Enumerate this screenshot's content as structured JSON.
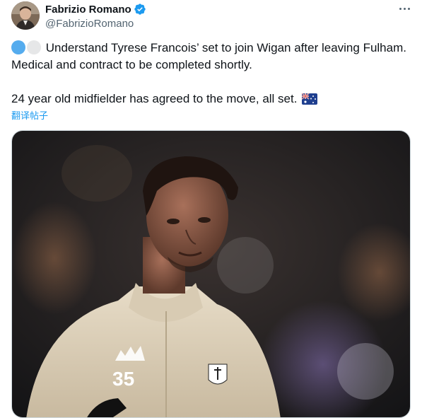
{
  "tweet": {
    "author": {
      "display_name": "Fabrizio Romano",
      "handle": "@FabrizioRomano",
      "verified": true,
      "avatar_icon": "profile-photo"
    },
    "more_icon": "ellipsis-icon",
    "text_line1": "Understand Tyrese Francois’ set to join Wigan after leaving Fulham. Medical and contract to be completed shortly.",
    "text_line2": "24 year old midfielder has agreed to the move, all set.",
    "emoji_prefix": [
      "blue-circle",
      "white-circle"
    ],
    "emoji_suffix": "australia-flag",
    "translate_label": "翻译帖子",
    "media": {
      "type": "photo",
      "description_icon": "player-photo",
      "jersey_number": "35"
    },
    "colors": {
      "accent": "#1d9bf0",
      "text": "#0f1419",
      "secondary": "#536471"
    }
  }
}
